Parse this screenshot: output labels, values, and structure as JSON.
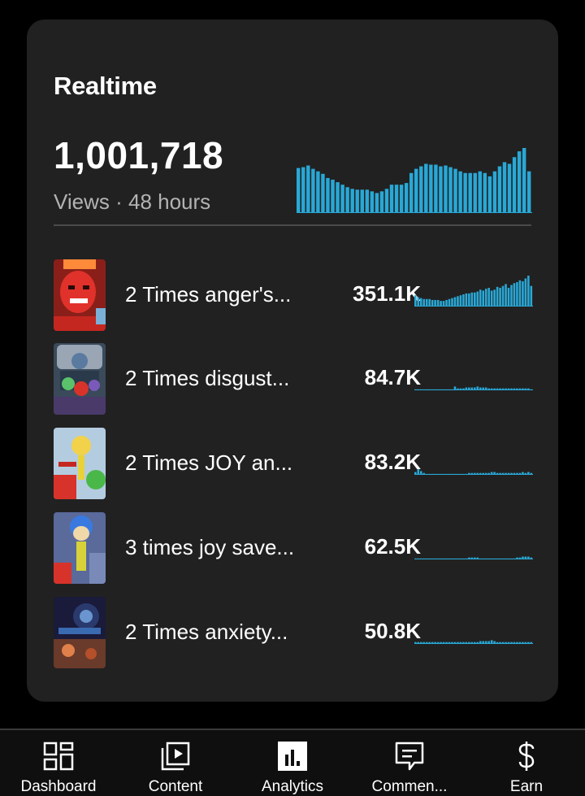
{
  "realtime": {
    "title": "Realtime",
    "total_views": "1,001,718",
    "caption": "Views · 48 hours",
    "bar_color": "#29a8d6",
    "chart_data": {
      "type": "bar",
      "title": "",
      "values": [
        54,
        55,
        57,
        53,
        50,
        47,
        42,
        40,
        37,
        34,
        31,
        29,
        28,
        28,
        28,
        26,
        24,
        26,
        29,
        34,
        34,
        34,
        36,
        48,
        53,
        56,
        59,
        58,
        58,
        56,
        57,
        55,
        53,
        50,
        48,
        48,
        48,
        50,
        48,
        44,
        50,
        56,
        61,
        59,
        67,
        74,
        78,
        50
      ]
    }
  },
  "videos": [
    {
      "title": "2 Times anger's...",
      "views": "351.1K",
      "thumb_icon": "anger-thumbnail",
      "spark": [
        12,
        10,
        9,
        8,
        8,
        8,
        7,
        7,
        7,
        6,
        6,
        7,
        8,
        9,
        10,
        11,
        12,
        13,
        14,
        14,
        15,
        15,
        16,
        18,
        17,
        19,
        20,
        17,
        18,
        21,
        20,
        22,
        24,
        20,
        23,
        25,
        26,
        28,
        27,
        30,
        33,
        22
      ]
    },
    {
      "title": "2 Times disgust...",
      "views": "84.7K",
      "thumb_icon": "disgust-thumbnail",
      "spark": [
        1,
        1,
        1,
        1,
        1,
        1,
        1,
        1,
        1,
        1,
        1,
        1,
        1,
        1,
        4,
        2,
        2,
        2,
        3,
        3,
        3,
        3,
        4,
        3,
        3,
        3,
        2,
        2,
        2,
        2,
        2,
        2,
        2,
        2,
        2,
        2,
        2,
        2,
        2,
        2,
        2,
        1
      ]
    },
    {
      "title": "2 Times JOY an...",
      "views": "83.2K",
      "thumb_icon": "joy-thumbnail",
      "spark": [
        3,
        6,
        4,
        2,
        1,
        1,
        1,
        1,
        1,
        1,
        1,
        1,
        1,
        1,
        1,
        1,
        1,
        1,
        1,
        2,
        2,
        2,
        2,
        2,
        2,
        2,
        2,
        3,
        3,
        2,
        2,
        2,
        2,
        2,
        2,
        2,
        2,
        2,
        3,
        2,
        3,
        2
      ]
    },
    {
      "title": "3 times joy save...",
      "views": "62.5K",
      "thumb_icon": "joy-blue-thumbnail",
      "spark": [
        1,
        1,
        1,
        1,
        1,
        1,
        1,
        1,
        1,
        1,
        1,
        1,
        1,
        1,
        1,
        1,
        1,
        1,
        1,
        2,
        2,
        2,
        2,
        1,
        1,
        1,
        1,
        1,
        1,
        1,
        1,
        1,
        1,
        1,
        1,
        1,
        2,
        2,
        3,
        3,
        3,
        2
      ]
    },
    {
      "title": "2 Times anxiety...",
      "views": "50.8K",
      "thumb_icon": "anxiety-thumbnail",
      "spark": [
        2,
        2,
        2,
        2,
        2,
        2,
        2,
        2,
        2,
        2,
        2,
        2,
        2,
        2,
        2,
        2,
        2,
        2,
        2,
        2,
        2,
        2,
        2,
        3,
        3,
        3,
        3,
        4,
        3,
        2,
        2,
        2,
        2,
        2,
        2,
        2,
        2,
        2,
        2,
        2,
        2,
        2
      ]
    }
  ],
  "nav": {
    "items": [
      {
        "label": "Dashboard",
        "icon": "dashboard-icon"
      },
      {
        "label": "Content",
        "icon": "content-icon"
      },
      {
        "label": "Analytics",
        "icon": "analytics-icon"
      },
      {
        "label": "Commen...",
        "icon": "comments-icon"
      },
      {
        "label": "Earn",
        "icon": "earn-icon"
      }
    ]
  }
}
